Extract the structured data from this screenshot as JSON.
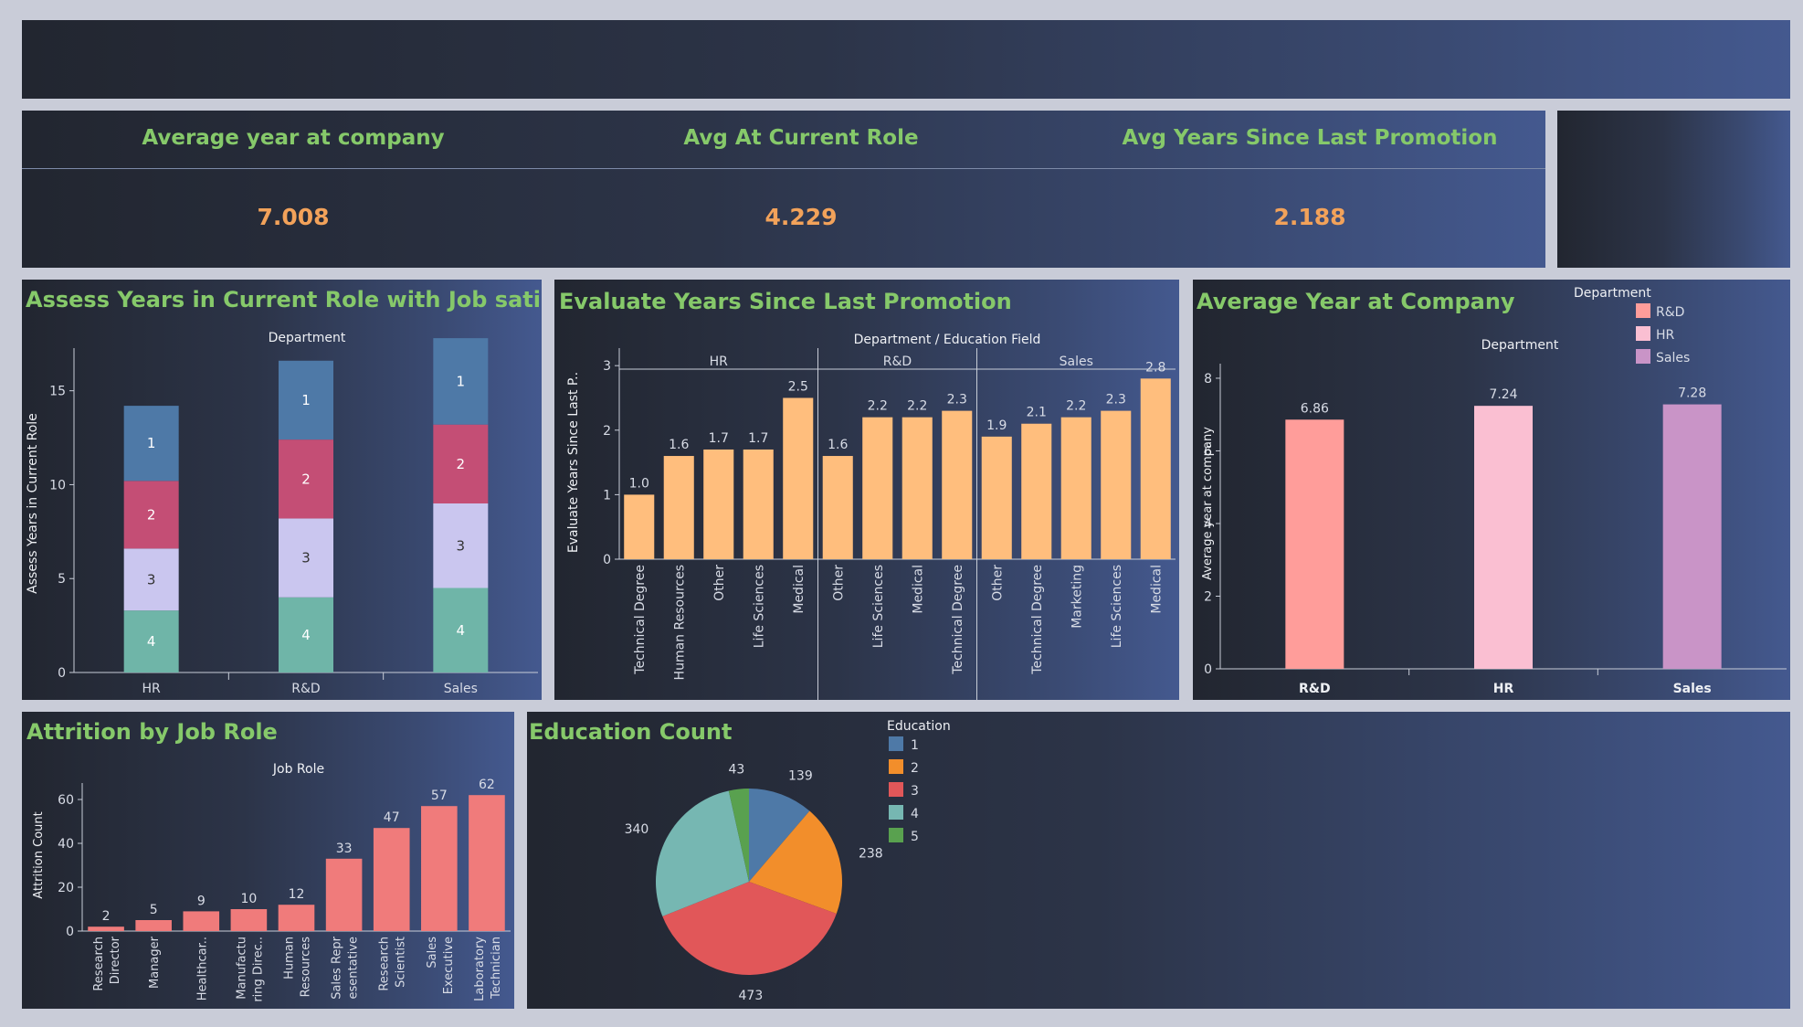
{
  "kpis": [
    {
      "label": "Average year at company",
      "value": "7.008"
    },
    {
      "label": "Avg At Current Role",
      "value": "4.229"
    },
    {
      "label": "Avg Years Since Last Promotion",
      "value": "2.188"
    }
  ],
  "colors": {
    "edu1": "#4e79a7",
    "edu2": "#f28e2b",
    "edu3": "#e15759",
    "edu4": "#76b7b2",
    "edu5": "#59a14f",
    "sat1": "#4e79a7",
    "sat2": "#c44e75",
    "sat3": "#cac6ef",
    "sat4": "#6fb5a8",
    "promo": "#ffbe7d",
    "attrition": "#f07b7b",
    "rd": "#ff9d9a",
    "hr": "#fabfd2",
    "sales": "#c994c7",
    "title": "#86c96a",
    "kpi_value": "#f2a25a"
  },
  "chart_data": [
    {
      "id": "current-role",
      "type": "bar",
      "stacked": true,
      "title": "Assess Years in Current Role with Job satisfaction",
      "header": "Department",
      "ylabel": "Assess Years in Current Role",
      "categories": [
        "HR",
        "R&D",
        "Sales"
      ],
      "series": [
        {
          "name": "1",
          "values": [
            4.0,
            4.2,
            4.6
          ]
        },
        {
          "name": "2",
          "values": [
            3.6,
            4.2,
            4.2
          ]
        },
        {
          "name": "3",
          "values": [
            3.3,
            4.2,
            4.5
          ]
        },
        {
          "name": "4",
          "values": [
            3.3,
            4.0,
            4.5
          ]
        }
      ],
      "ylim": [
        0,
        18
      ],
      "yticks": [
        0,
        5,
        10,
        15
      ]
    },
    {
      "id": "promotion",
      "type": "bar",
      "title": "Evaluate Years Since Last Promotion",
      "header": "Department  /  Education Field",
      "ylabel": "Evaluate Years Since Last P..",
      "groups": [
        {
          "name": "HR",
          "categories": [
            "Technical Degree",
            "Human Resources",
            "Other",
            "Life Sciences",
            "Medical"
          ],
          "values": [
            1.0,
            1.6,
            1.7,
            1.7,
            2.5
          ],
          "labels": [
            "1.0",
            "1.6",
            "1.7",
            "1.7",
            "2.5"
          ]
        },
        {
          "name": "R&D",
          "categories": [
            "Other",
            "Life Sciences",
            "Medical",
            "Technical Degree"
          ],
          "values": [
            1.6,
            2.2,
            2.2,
            2.3
          ],
          "labels": [
            "1.6",
            "2.2",
            "2.2",
            "2.3"
          ]
        },
        {
          "name": "Sales",
          "categories": [
            "Other",
            "Technical Degree",
            "Marketing",
            "Life Sciences",
            "Medical"
          ],
          "values": [
            1.9,
            2.1,
            2.2,
            2.3,
            2.8
          ],
          "labels": [
            "1.9",
            "2.1",
            "2.2",
            "2.3",
            "2.8"
          ]
        }
      ],
      "ylim": [
        0,
        3.3
      ],
      "yticks": [
        0,
        1,
        2,
        3
      ]
    },
    {
      "id": "year-at-company",
      "type": "bar",
      "title": "Average Year at Company",
      "header": "Department",
      "ylabel": "Average year at company",
      "categories": [
        "R&D",
        "HR",
        "Sales"
      ],
      "values": [
        6.86,
        7.24,
        7.28
      ],
      "labels": [
        "6.86",
        "7.24",
        "7.28"
      ],
      "legend_title": "Department",
      "legend": [
        "R&D",
        "HR",
        "Sales"
      ],
      "ylim": [
        0,
        8.2
      ],
      "yticks": [
        0,
        2,
        4,
        6,
        8
      ]
    },
    {
      "id": "attrition",
      "type": "bar",
      "title": "Attrition by Job Role",
      "header": "Job Role",
      "ylabel": "Attrition Count",
      "categories": [
        [
          "Research",
          "Director"
        ],
        [
          "Manager"
        ],
        [
          "Healthcar.."
        ],
        [
          "Manufactu",
          "ring Direc.."
        ],
        [
          "Human",
          "Resources"
        ],
        [
          "Sales Repr",
          "esentative"
        ],
        [
          "Research",
          "Scientist"
        ],
        [
          "Sales",
          "Executive"
        ],
        [
          "Laboratory",
          "Technician"
        ]
      ],
      "values": [
        2,
        5,
        9,
        10,
        12,
        33,
        47,
        57,
        62
      ],
      "labels": [
        "2",
        "5",
        "9",
        "10",
        "12",
        "33",
        "47",
        "57",
        "62"
      ],
      "ylim": [
        0,
        75
      ],
      "yticks": [
        0,
        20,
        40,
        60
      ]
    },
    {
      "id": "education",
      "type": "pie",
      "title": "Education Count",
      "legend_title": "Education",
      "legend": [
        "1",
        "2",
        "3",
        "4",
        "5"
      ],
      "values": [
        139,
        238,
        473,
        340,
        43
      ],
      "labels": [
        "139",
        "238",
        "473",
        "340",
        "43"
      ]
    }
  ]
}
